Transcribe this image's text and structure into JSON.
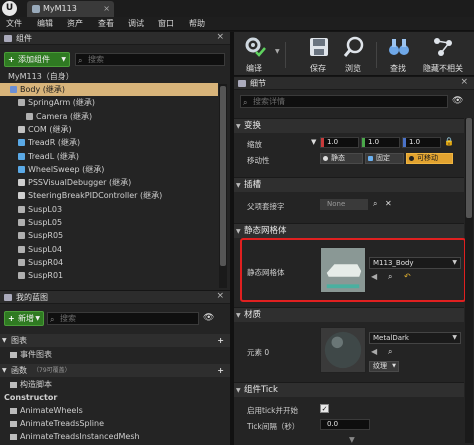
{
  "window": {
    "tab_title": "MyM113",
    "logo": "U"
  },
  "menu": [
    "文件",
    "编辑",
    "资产",
    "查看",
    "调试",
    "窗口",
    "帮助"
  ],
  "components_panel": {
    "title": "组件",
    "add_button": "添加组件",
    "search_placeholder": "搜索",
    "root": "MyM113（自身）",
    "tree": [
      {
        "label": "Body (继承)",
        "indent": 1,
        "icon_color": "#6c8fd4",
        "selected": true
      },
      {
        "label": "SpringArm (继承)",
        "indent": 2,
        "icon_color": "#b0b0b0",
        "selected": false
      },
      {
        "label": "Camera (继承)",
        "indent": 3,
        "icon_color": "#b0b0b0",
        "selected": false
      },
      {
        "label": "COM (继承)",
        "indent": 2,
        "icon_color": "#c0c0c0",
        "selected": false
      },
      {
        "label": "TreadR (继承)",
        "indent": 2,
        "icon_color": "#5aa9e6",
        "selected": false
      },
      {
        "label": "TreadL (继承)",
        "indent": 2,
        "icon_color": "#5aa9e6",
        "selected": false
      },
      {
        "label": "WheelSweep (继承)",
        "indent": 2,
        "icon_color": "#5aa9e6",
        "selected": false
      },
      {
        "label": "PSSVisualDebugger (继承)",
        "indent": 2,
        "icon_color": "#cfcfcf",
        "selected": false
      },
      {
        "label": "SteeringBreakPIDController (继承)",
        "indent": 2,
        "icon_color": "#cfcfcf",
        "selected": false
      },
      {
        "label": "SuspL03",
        "indent": 2,
        "icon_color": "#b0b0b0",
        "selected": false
      },
      {
        "label": "SuspL05",
        "indent": 2,
        "icon_color": "#b0b0b0",
        "selected": false
      },
      {
        "label": "SuspR05",
        "indent": 2,
        "icon_color": "#b0b0b0",
        "selected": false
      },
      {
        "label": "SuspL04",
        "indent": 2,
        "icon_color": "#b0b0b0",
        "selected": false
      },
      {
        "label": "SuspR04",
        "indent": 2,
        "icon_color": "#b0b0b0",
        "selected": false
      },
      {
        "label": "SuspR01",
        "indent": 2,
        "icon_color": "#b0b0b0",
        "selected": false
      }
    ]
  },
  "blueprint_panel": {
    "title": "我的蓝图",
    "new_button": "新增",
    "search_placeholder": "搜索",
    "graphs_label": "图表",
    "event_graph": "事件图表",
    "functions_label": "函数",
    "functions_count": "（79可覆盖）",
    "construction_script": "构造脚本",
    "constructor_label": "Constructor",
    "functions": [
      "AnimateWheels",
      "AnimateTreadsSpline",
      "AnimateTreadsInstancedMesh"
    ]
  },
  "toolbar": {
    "buttons": [
      {
        "label": "编译",
        "icon": "gear-check-icon"
      },
      {
        "label": "保存",
        "icon": "save-icon"
      },
      {
        "label": "浏览",
        "icon": "browse-icon"
      },
      {
        "label": "查找",
        "icon": "binoculars-icon"
      },
      {
        "label": "隐藏不相关",
        "icon": "hide-unrelated-icon"
      }
    ]
  },
  "details_panel": {
    "title": "细节",
    "search_placeholder": "搜索详情",
    "transform": {
      "category": "变换",
      "scale_label": "缩放",
      "scale_values": [
        "1.0",
        "1.0",
        "1.0"
      ],
      "mobility_label": "移动性",
      "mobility_options": [
        "静态",
        "固定",
        "可移动"
      ],
      "mobility_selected": "可移动"
    },
    "sockets": {
      "category": "插槽",
      "parent_socket_label": "父项套接字",
      "parent_socket_value": "None"
    },
    "static_mesh": {
      "category": "静态网格体",
      "label": "静态网格体",
      "value": "M113_Body"
    },
    "materials": {
      "category": "材质",
      "element_label": "元素 0",
      "value": "MetalDark",
      "texture_button": "纹理"
    },
    "component_tick": {
      "category": "组件Tick",
      "start_with_tick_label": "启用tick并开始",
      "start_with_tick_checked": true,
      "tick_interval_label": "Tick间隔（秒）",
      "tick_interval_value": "0.0"
    }
  },
  "colors": {
    "selection": "#d8b47a",
    "highlight_border": "#e02020",
    "green_button": "#2f7a22",
    "movable_on": "#e2a330"
  }
}
